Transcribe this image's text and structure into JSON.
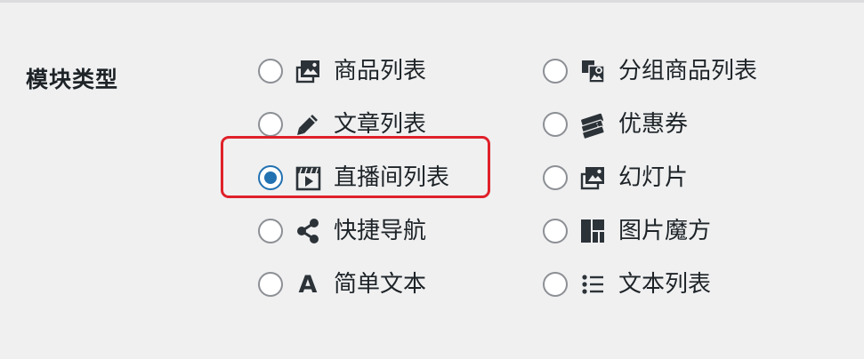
{
  "field": {
    "label": "模块类型"
  },
  "options_left": [
    {
      "label": "商品列表",
      "icon": "images-icon",
      "checked": false
    },
    {
      "label": "文章列表",
      "icon": "pencil-icon",
      "checked": false
    },
    {
      "label": "直播间列表",
      "icon": "video-clapper-icon",
      "checked": true
    },
    {
      "label": "快捷导航",
      "icon": "share-icon",
      "checked": false
    },
    {
      "label": "简单文本",
      "icon": "letter-a-icon",
      "glyph": "A",
      "checked": false
    }
  ],
  "options_right": [
    {
      "label": "分组商品列表",
      "icon": "group-products-icon",
      "checked": false
    },
    {
      "label": "优惠券",
      "icon": "tickets-icon",
      "checked": false
    },
    {
      "label": "幻灯片",
      "icon": "slides-icon",
      "checked": false
    },
    {
      "label": "图片魔方",
      "icon": "grid-layout-icon",
      "checked": false
    },
    {
      "label": "文本列表",
      "icon": "list-icon",
      "checked": false
    }
  ],
  "colors": {
    "background": "#f0f0f1",
    "radio_checked": "#2271b1",
    "highlight_border": "#e0212a"
  }
}
